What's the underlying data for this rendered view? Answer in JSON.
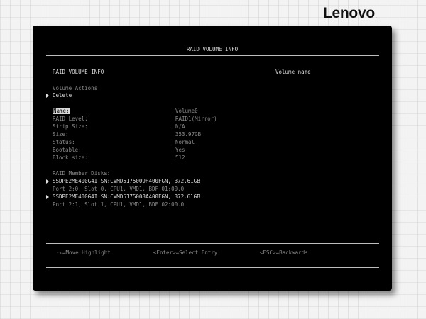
{
  "brand": {
    "name": "Lenovo",
    "dot": "."
  },
  "screen": {
    "title": "RAID VOLUME INFO",
    "section_title": "RAID VOLUME INFO",
    "help_text": "Volume name",
    "actions_label": "Volume Actions",
    "delete_label": "Delete",
    "fields": [
      {
        "label": "Name:",
        "value": "Volume0"
      },
      {
        "label": "RAID Level:",
        "value": "RAID1(Mirror)"
      },
      {
        "label": "Strip Size:",
        "value": "N/A"
      },
      {
        "label": "Size:",
        "value": "353.97GB"
      },
      {
        "label": "Status:",
        "value": "Normal"
      },
      {
        "label": "Bootable:",
        "value": "Yes"
      },
      {
        "label": "Block size:",
        "value": "512"
      }
    ],
    "member_disks_label": "RAID Member Disks:",
    "disks": [
      {
        "name": "SSDPE2ME400G4I SN:CVMD5175009H400FGN, 372.61GB",
        "port": "Port  2:0, Slot   0, CPU1, VMD1, BDF 01:00.0"
      },
      {
        "name": "SSDPE2ME400G4I SN:CVMD5175008A400FGN, 372.61GB",
        "port": "Port  2:1, Slot   1, CPU1, VMD1, BDF 02:00.0"
      }
    ],
    "footer": {
      "move": "↑↓=Move Highlight",
      "select": "<Enter>=Select Entry",
      "back": "<ESC>=Backwards"
    }
  }
}
